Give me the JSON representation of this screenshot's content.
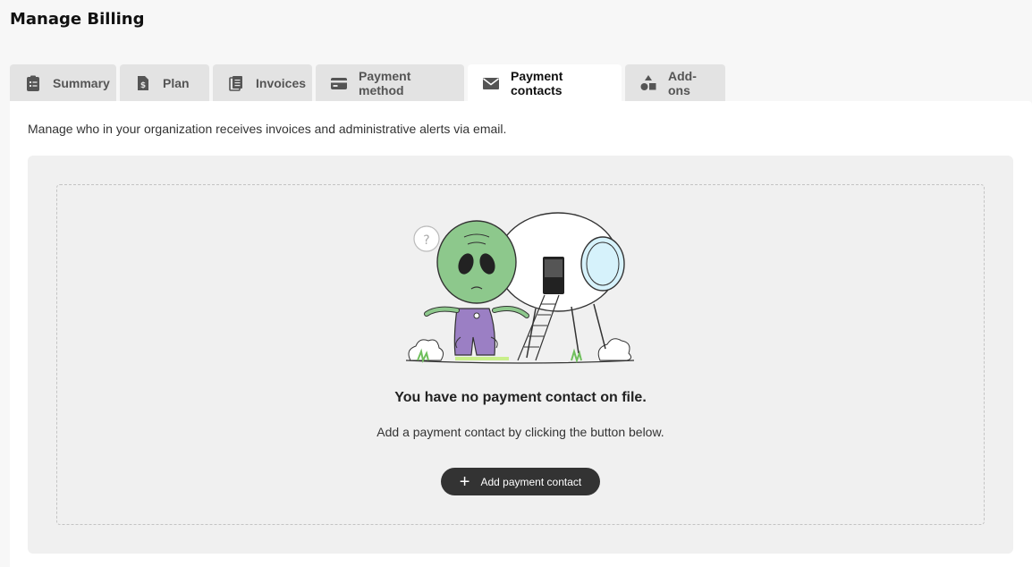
{
  "page": {
    "title": "Manage Billing"
  },
  "tabs": [
    {
      "label": "Summary",
      "icon": "clipboard-list-icon",
      "active": false
    },
    {
      "label": "Plan",
      "icon": "dollar-document-icon",
      "active": false
    },
    {
      "label": "Invoices",
      "icon": "documents-icon",
      "active": false
    },
    {
      "label": "Payment method",
      "icon": "credit-card-icon",
      "active": false
    },
    {
      "label": "Payment contacts",
      "icon": "envelope-icon",
      "active": true
    },
    {
      "label": "Add-ons",
      "icon": "shapes-icon",
      "active": false
    }
  ],
  "panel": {
    "description": "Manage who in your organization receives invoices and administrative alerts via email.",
    "empty_state": {
      "title": "You have no payment contact on file.",
      "subtitle": "Add a payment contact by clicking the button below.",
      "button_label": "Add payment contact"
    }
  },
  "colors": {
    "tab_bg": "#e3e3e3",
    "active_tab_bg": "#ffffff",
    "button_bg": "#333333",
    "empty_bg": "#f0f0f0"
  }
}
